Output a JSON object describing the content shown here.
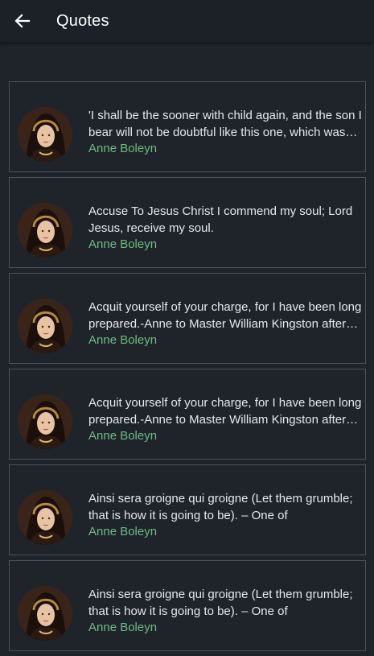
{
  "app": {
    "title": "Quotes",
    "accent_color": "#6abf7d",
    "back_icon": "arrow-left-icon"
  },
  "quotes": [
    {
      "text": "'I shall be the sooner with child again, and the son I bear will not be doubtful like this one, which was…",
      "author": "Anne Boleyn"
    },
    {
      "text": "Accuse To Jesus Christ I commend my soul; Lord Jesus, receive my soul.",
      "author": "Anne Boleyn"
    },
    {
      "text": "Acquit yourself of your charge, for I have been long prepared.-Anne to Master William Kingston after…",
      "author": "Anne Boleyn"
    },
    {
      "text": "Acquit yourself of your charge, for I have been long prepared.-Anne to Master William Kingston after…",
      "author": "Anne Boleyn"
    },
    {
      "text": "Ainsi sera groigne qui groigne (Let them grumble; that is how it is going to be). – One of",
      "author": "Anne Boleyn"
    },
    {
      "text": "Ainsi sera groigne qui groigne (Let them grumble; that is how it is going to be). – One of",
      "author": "Anne Boleyn"
    }
  ]
}
